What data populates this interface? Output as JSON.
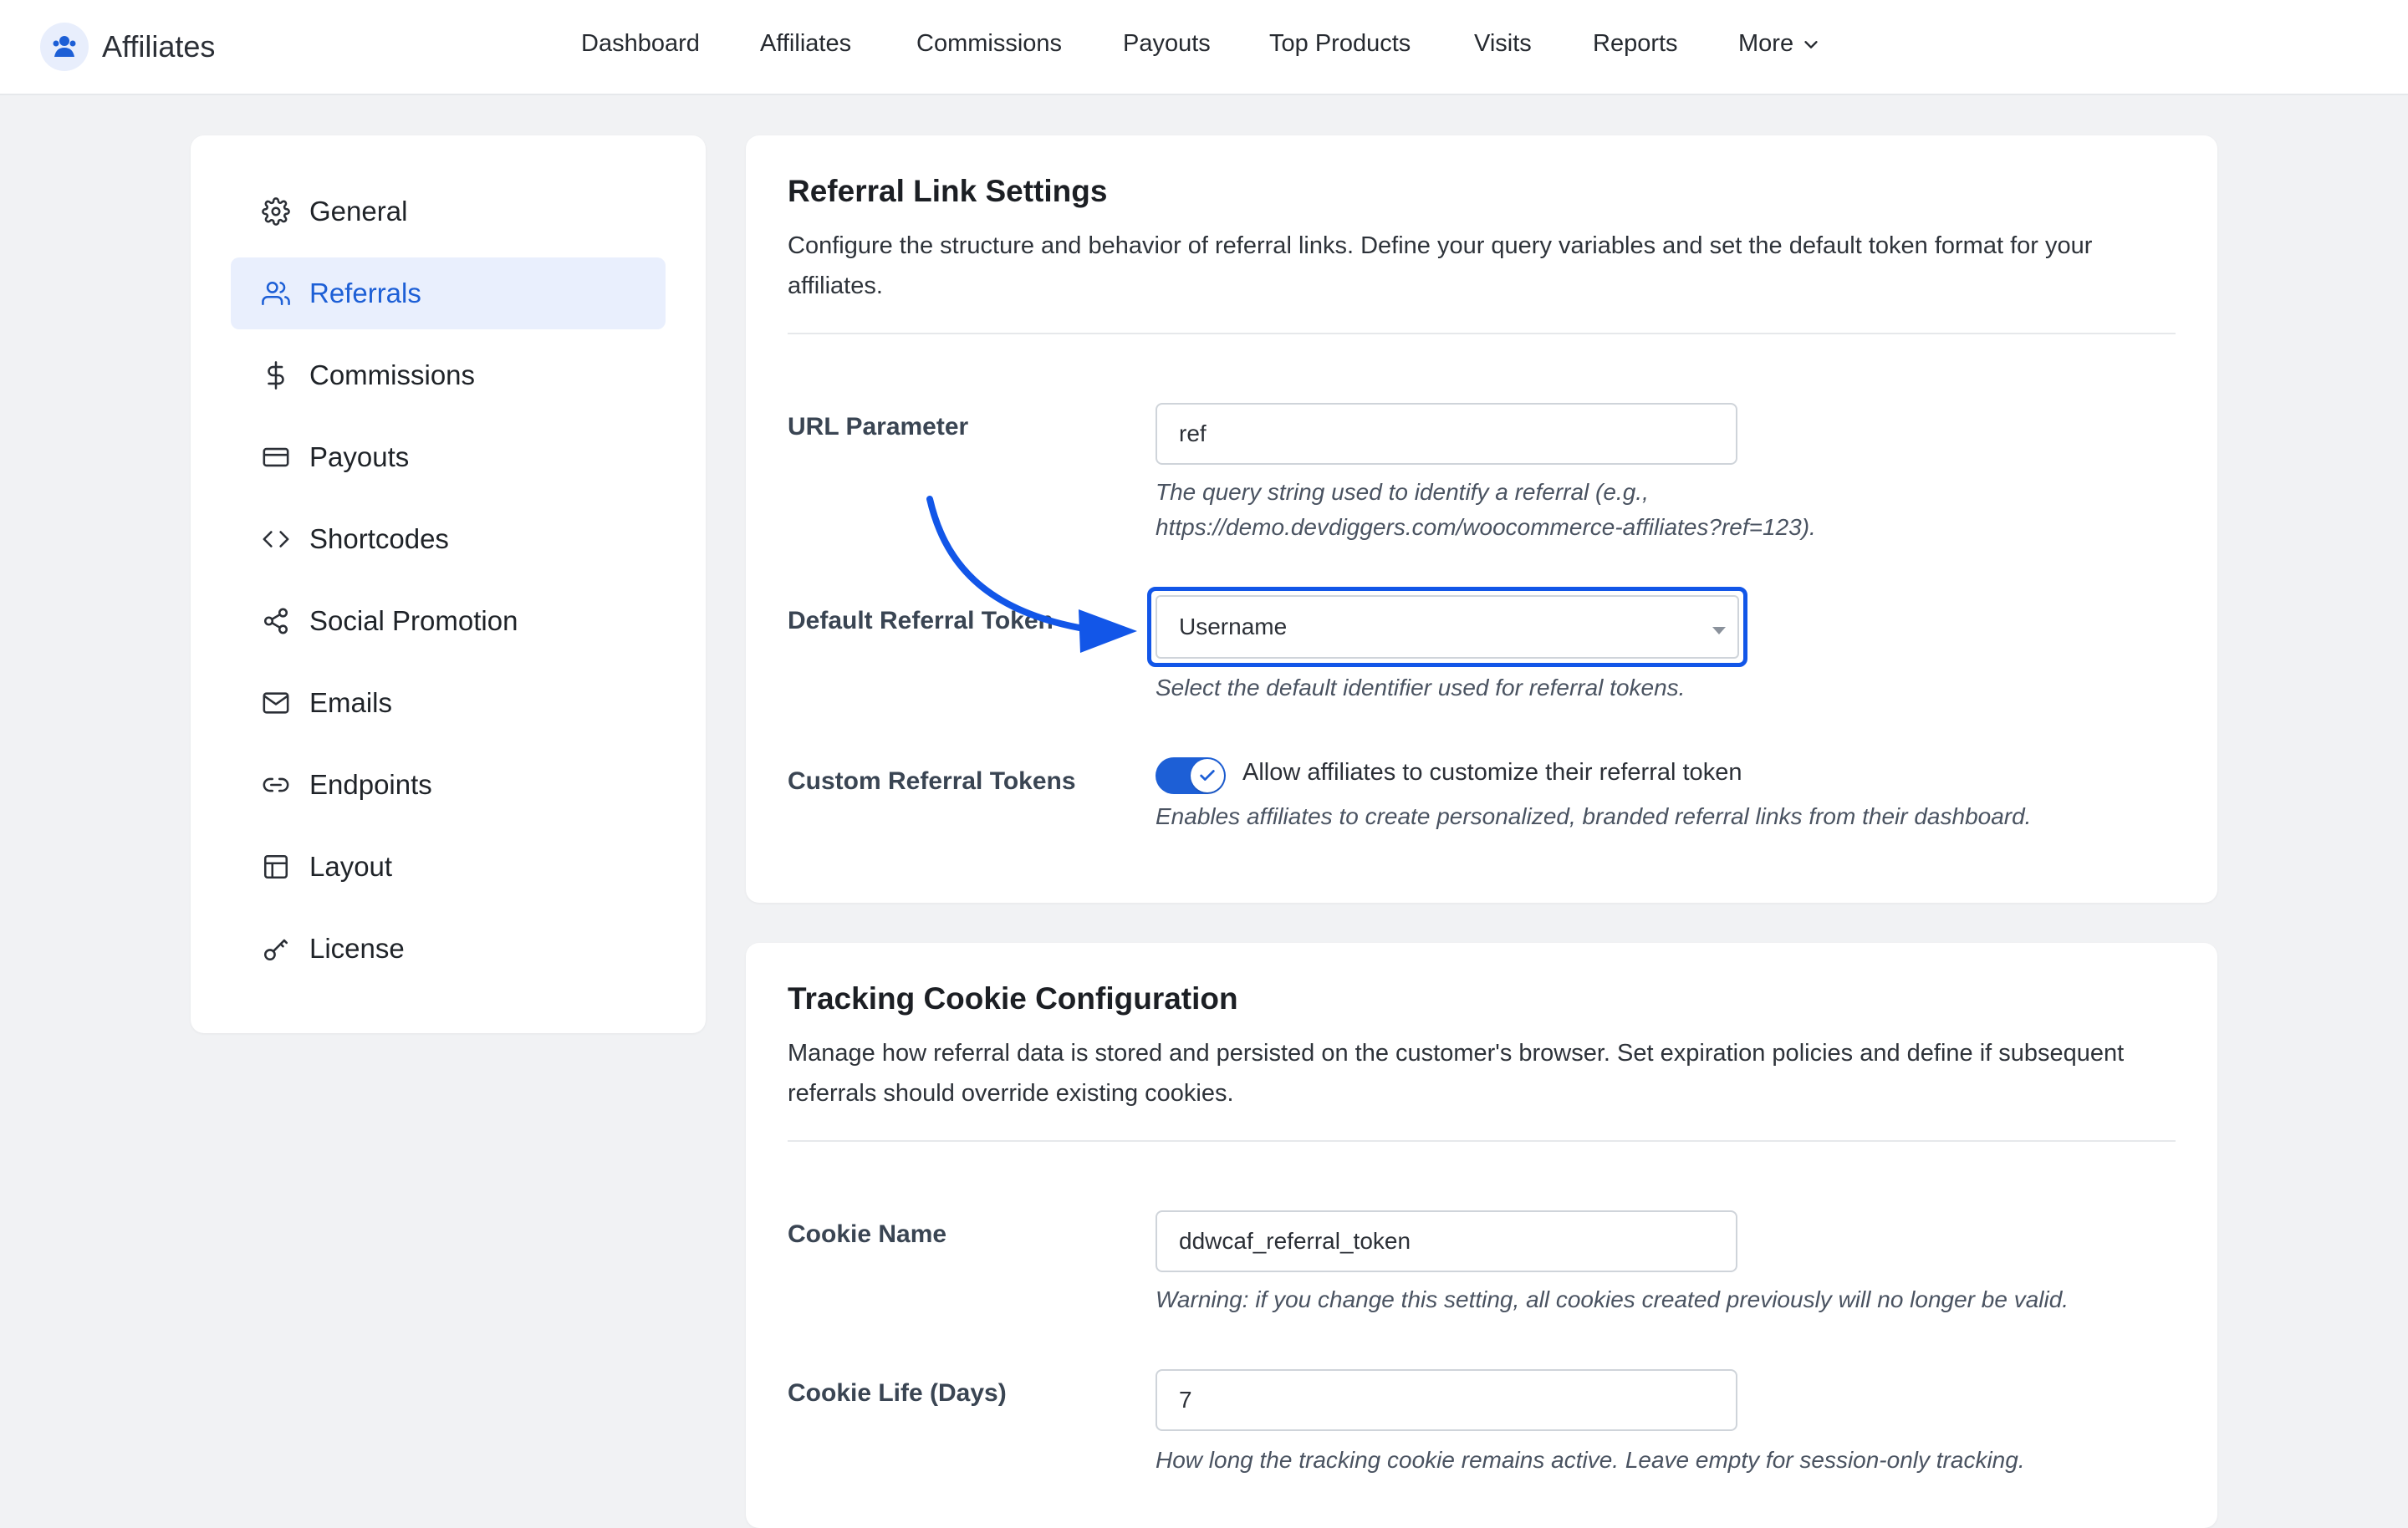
{
  "app": {
    "title": "Affiliates",
    "logo_icon": "affiliates-logo-icon"
  },
  "nav": {
    "items": [
      "Dashboard",
      "Affiliates",
      "Commissions",
      "Payouts",
      "Top Products",
      "Visits",
      "Reports",
      "More"
    ]
  },
  "sidebar": {
    "items": [
      {
        "label": "General",
        "icon": "gear-icon",
        "active": false
      },
      {
        "label": "Referrals",
        "icon": "users-icon",
        "active": true
      },
      {
        "label": "Commissions",
        "icon": "dollar-icon",
        "active": false
      },
      {
        "label": "Payouts",
        "icon": "credit-card-icon",
        "active": false
      },
      {
        "label": "Shortcodes",
        "icon": "code-icon",
        "active": false
      },
      {
        "label": "Social Promotion",
        "icon": "share-icon",
        "active": false
      },
      {
        "label": "Emails",
        "icon": "mail-icon",
        "active": false
      },
      {
        "label": "Endpoints",
        "icon": "link-icon",
        "active": false
      },
      {
        "label": "Layout",
        "icon": "layout-icon",
        "active": false
      },
      {
        "label": "License",
        "icon": "key-icon",
        "active": false
      }
    ]
  },
  "referral_card": {
    "title": "Referral Link Settings",
    "description": "Configure the structure and behavior of referral links. Define your query variables and set the default token format for your affiliates.",
    "url_parameter": {
      "label": "URL Parameter",
      "value": "ref",
      "help_line1": "The query string used to identify a referral (e.g.,",
      "help_line2": "https://demo.devdiggers.com/woocommerce-affiliates?ref=123)."
    },
    "default_token": {
      "label": "Default Referral Token",
      "selected": "Username",
      "help": "Select the default identifier used for referral tokens."
    },
    "custom_tokens": {
      "label": "Custom Referral Tokens",
      "toggle_on": true,
      "toggle_label": "Allow affiliates to customize their referral token",
      "help": "Enables affiliates to create personalized, branded referral links from their dashboard."
    }
  },
  "cookie_card": {
    "title": "Tracking Cookie Configuration",
    "description": "Manage how referral data is stored and persisted on the customer's browser. Set expiration policies and define if subsequent referrals should override existing cookies.",
    "cookie_name": {
      "label": "Cookie Name",
      "value": "ddwcaf_referral_token",
      "help": "Warning: if you change this setting, all cookies created previously will no longer be valid."
    },
    "cookie_life": {
      "label": "Cookie Life (Days)",
      "value": "7",
      "help": "How long the tracking cookie remains active. Leave empty for session-only tracking."
    }
  },
  "colors": {
    "accent": "#1d5fd6",
    "highlight": "#1256e8",
    "active_bg": "#e9effd",
    "page_bg": "#f1f2f4"
  }
}
